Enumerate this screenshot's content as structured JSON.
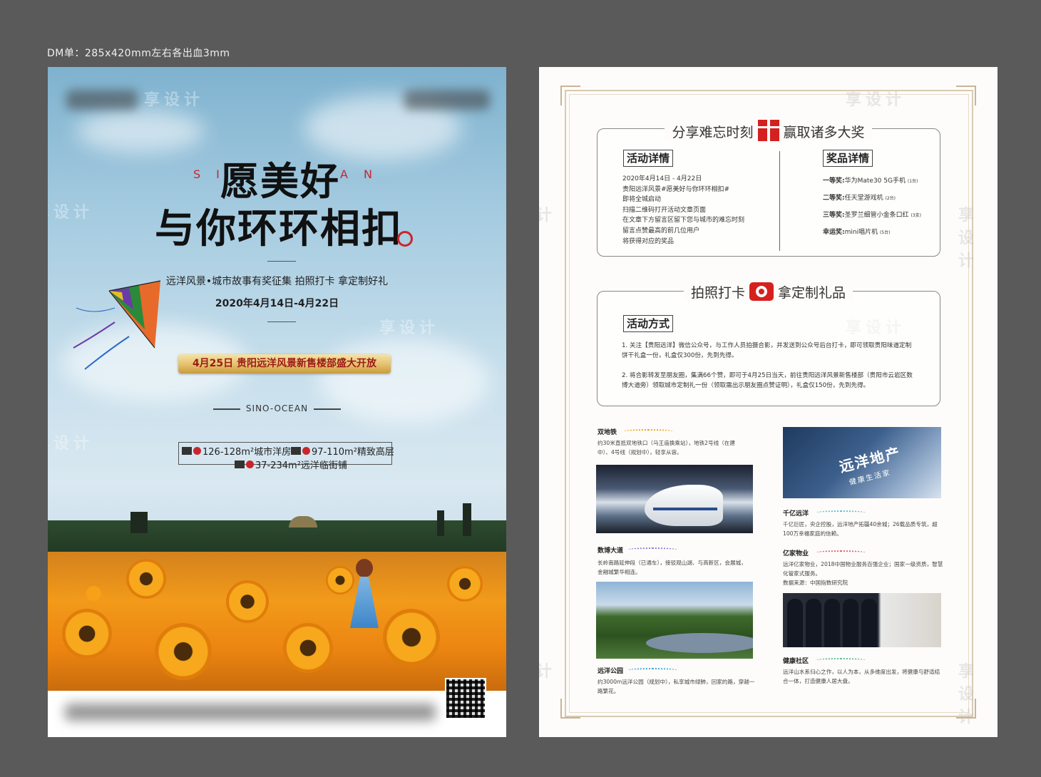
{
  "spec_label": "DM单：285x420mm左右各出血3mm",
  "front": {
    "slogan_line1": "愿美好",
    "slogan_line2": "与你环环相扣",
    "deco_left": "SI",
    "deco_right": "AN",
    "subtitle": "远洋风景•城市故事有奖征集  拍照打卡  拿定制好礼",
    "date_range": "2020年4月14日-4月22日",
    "open_banner": "4月25日 贵阳远洋风景新售楼部盛大开放",
    "brand": "SINO-OCEAN",
    "products": [
      "126-128m²城市洋房",
      "97-110m²精致高层",
      "37-234m²远洋临街铺"
    ],
    "watermark": "享设计"
  },
  "back": {
    "panel1": {
      "title_left": "分享难忘时刻",
      "title_right": "赢取诸多大奖",
      "activity_tag": "活动详情",
      "activity_lines": [
        "2020年4月14日 - 4月22日",
        "贵阳远洋风景#愿美好与你环环相扣#",
        "即将全城启动",
        "扫描二维码打开活动文章页面",
        "在文章下方留言区留下您与城市的难忘时刻",
        "留言点赞最高的前几位用户",
        "将获得对应的奖品"
      ],
      "prize_tag": "奖品详情",
      "prizes": [
        {
          "level": "一等奖:",
          "item": "华为Mate30 5G手机",
          "count": "(1台)"
        },
        {
          "level": "二等奖:",
          "item": "任天堂游戏机",
          "count": "(2台)"
        },
        {
          "level": "三等奖:",
          "item": "圣罗兰细管小金条口红",
          "count": "(3支)"
        },
        {
          "level": "幸运奖:",
          "item": "mini唱片机",
          "count": "(5台)"
        }
      ]
    },
    "panel2": {
      "title_left": "拍照打卡",
      "title_right": "拿定制礼品",
      "method_tag": "活动方式",
      "method_1": "1. 关注【贵阳远洋】微信公众号，与工作人员拍摄合影，并发送到公众号后台打卡，即可领取贵阳味道定制饼干礼盒一份，礼盒仅300份，先到先得。",
      "method_2": "2. 将合影转发至朋友圈，集满66个赞，即可于4月25日当天，前往贵阳远洋风景新售楼部（贵阳市云岩区数博大道旁）领取城市定制礼一份（领取需出示朋友圈点赞证明），礼盒仅150份，先到先得。"
    },
    "features": [
      {
        "title": "双地铁",
        "text": "约30米直抵双地铁口（马王庙换乘站），地铁2号线（在建中）、4号线（规划中），轻享从容。",
        "wave": "#f0a020"
      },
      {
        "title": "数博大道",
        "text": "长岭南路延伸段（已通车），接驳观山湖、与高新区，会展城，金融城繁华相连。",
        "wave": "#8a7fd0"
      },
      {
        "title": "远洋公园",
        "text": "约3000m远洋公园（规划中），私享城市绿肺，回家的路，穿越一路繁花。",
        "wave": "#3aa8d8"
      },
      {
        "title": "千亿远洋",
        "text": "千亿巨匠，央企控股，远洋地产拓疆40余城；26载品质专筑，超100万幸福家庭的信赖。",
        "wave": "#5fc0d8"
      },
      {
        "title": "亿家物业",
        "text": "远洋亿家物业，2018中国物业服务百强企业；国家一级资质，智慧化管家式服务。",
        "text2": "数据来源：中国指数研究院",
        "wave": "#e06070"
      },
      {
        "title": "健康社区",
        "text": "远洋山水系归心之作，以人为本，从多维度出发，将健康与舒适结合一体，打造健康人居大盘。",
        "wave": "#60b890"
      }
    ],
    "building_sign": "远洋地产",
    "building_sub": "健康生活家"
  }
}
